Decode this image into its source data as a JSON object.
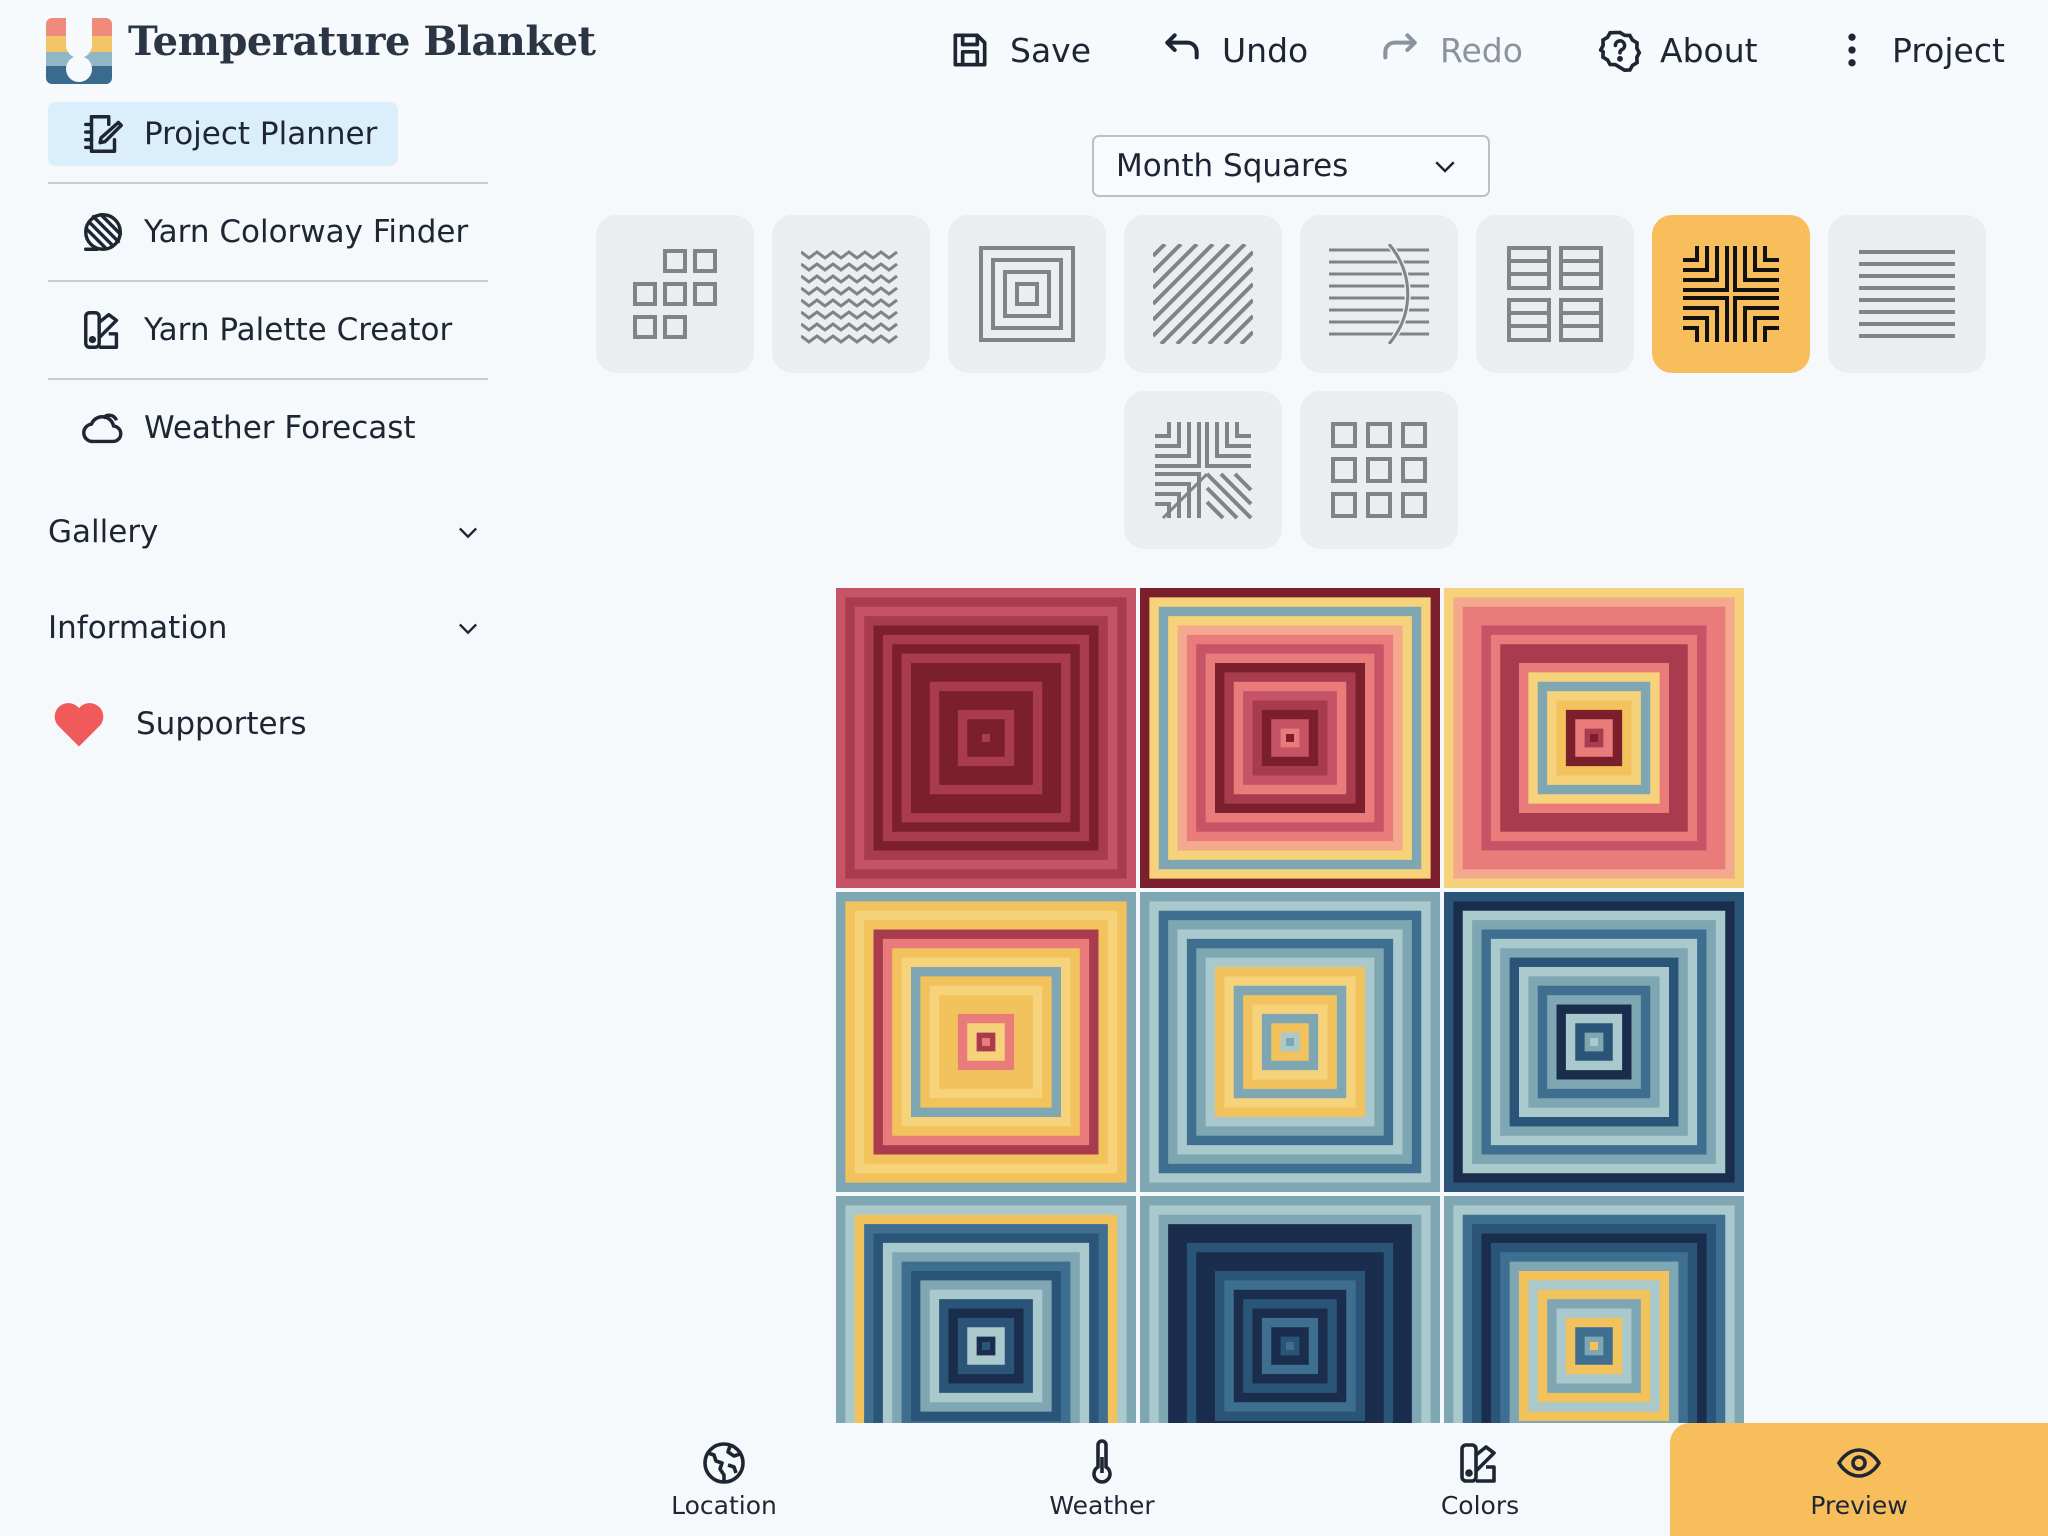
{
  "app": {
    "title": "Temperature Blanket"
  },
  "toolbar": {
    "save": "Save",
    "undo": "Undo",
    "redo": "Redo",
    "about": "About",
    "project": "Project"
  },
  "sidebar": {
    "items": [
      {
        "label": "Project Planner",
        "icon": "notebook-edit-icon",
        "active": true
      },
      {
        "label": "Yarn Colorway Finder",
        "icon": "yarn-ball-icon"
      },
      {
        "label": "Yarn Palette Creator",
        "icon": "swatch-book-icon"
      },
      {
        "label": "Weather Forecast",
        "icon": "cloud-icon"
      }
    ],
    "sections": [
      {
        "label": "Gallery"
      },
      {
        "label": "Information"
      }
    ],
    "supporters": "Supporters"
  },
  "pattern": {
    "selected_layout": "Month Squares",
    "options_count": 10,
    "selected_index": 6
  },
  "preview": {
    "tiles": 9,
    "palette": [
      "#7a1f2b",
      "#a83c4e",
      "#c65466",
      "#ea7b7b",
      "#f4a98f",
      "#f6d27a",
      "#f2c35c",
      "#a9c9cc",
      "#7fa6b3",
      "#3e6e90",
      "#2a5478",
      "#1b2d4c"
    ]
  },
  "bottom_nav": {
    "location": "Location",
    "weather": "Weather",
    "colors": "Colors",
    "preview": "Preview"
  },
  "colors": {
    "accent": "#f8be5c",
    "active_nav_bg": "#dbeefb",
    "heart": "#f05a5a"
  }
}
